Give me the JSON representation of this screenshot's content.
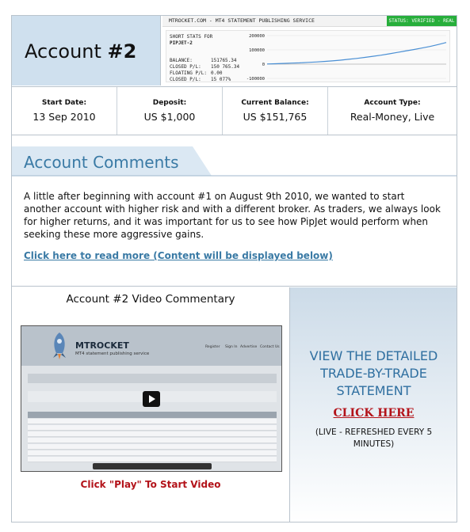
{
  "header": {
    "account_label": "Account",
    "account_number": "#2"
  },
  "statement_widget": {
    "site": "MTROCKET.COM - MT4 STATEMENT PUBLISHING SERVICE",
    "status": "STATUS: VERIFIED - REAL",
    "short_stats_label": "SHORT STATS FOR",
    "account_name": "PIPJET-2",
    "lines": [
      {
        "label": "BALANCE:",
        "value": "151765.34"
      },
      {
        "label": "CLOSED P/L:",
        "value": "150 765.34"
      },
      {
        "label": "FLOATING P/L:",
        "value": "0.00"
      },
      {
        "label": "CLOSED P/L:",
        "value": "15 077%"
      }
    ],
    "chart_data": {
      "type": "line",
      "y_ticks": [
        "200000",
        "100000",
        "0",
        "-100000"
      ],
      "ylim": [
        -100000,
        200000
      ],
      "series": [
        {
          "values": [
            1000,
            3000,
            5000,
            7000,
            9000,
            12000,
            15000,
            19000,
            23000,
            28000,
            34000,
            40000,
            47000,
            55000,
            63000,
            72000,
            82000,
            92000,
            102000,
            113000,
            124000,
            137000,
            151765
          ]
        }
      ],
      "line_color": "#4a8fd4"
    }
  },
  "stats": [
    {
      "label": "Start Date:",
      "value": "13 Sep 2010"
    },
    {
      "label": "Deposit:",
      "value": "US $1,000"
    },
    {
      "label": "Current Balance:",
      "value": "US $151,765"
    },
    {
      "label": "Account Type:",
      "value": "Real-Money, Live"
    }
  ],
  "comments": {
    "title": "Account Comments",
    "body": "A little after beginning with account #1 on August 9th 2010, we wanted to start another account with higher risk and with a different broker. As traders, we always look for higher returns, and it was important for us to see how PipJet would perform when seeking these more aggressive gains.",
    "read_more": "Click here to read more (Content will be displayed below)"
  },
  "video": {
    "title": "Account #2 Video Commentary",
    "cta": "Click \"Play\" To Start Video",
    "thumb_logo": "MTROCKET",
    "thumb_sub": "MT4 statement publishing service",
    "thumb_nav": [
      "Register",
      "Sign In",
      "Advertise",
      "Contact Us"
    ]
  },
  "statement_link": {
    "heading": "VIEW THE DETAILED TRADE-BY-TRADE STATEMENT",
    "link": "CLICK HERE",
    "note": "(LIVE - REFRESHED EVERY 5 MINUTES)"
  },
  "colors": {
    "accent_blue": "#3a7aa5",
    "link_red": "#b3131a",
    "header_bg": "#cfe0ee",
    "verified_green": "#27ae3b"
  }
}
